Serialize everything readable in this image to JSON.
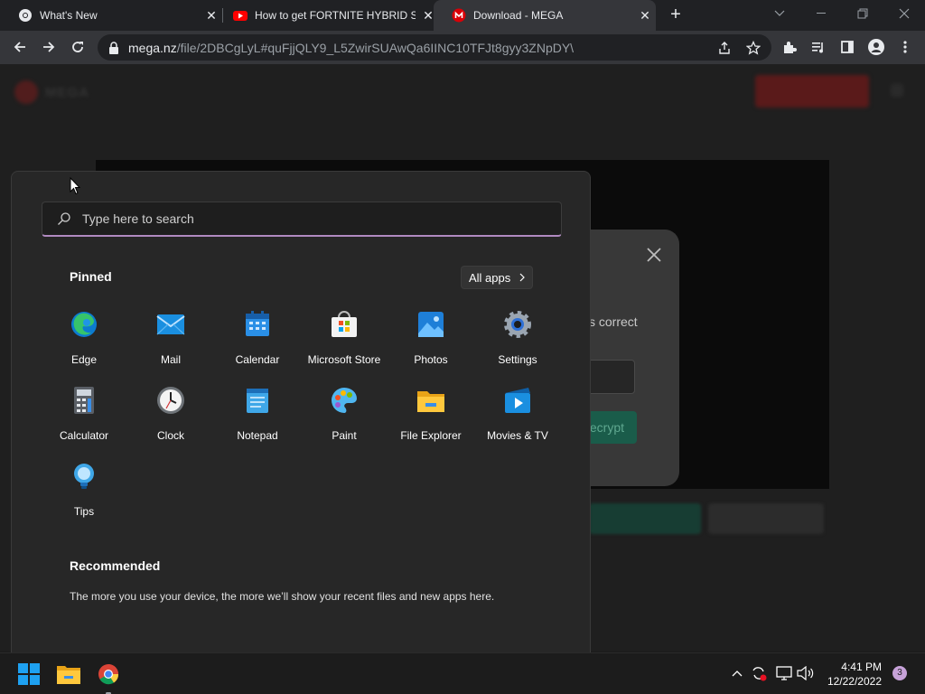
{
  "browser": {
    "tabs": [
      {
        "title": "What's New",
        "active": false
      },
      {
        "title": "How to get FORTNITE HYBRID SKIN",
        "active": false
      },
      {
        "title": "Download - MEGA",
        "active": true
      }
    ],
    "omnibox": {
      "host": "mega.nz",
      "path": "/file/2DBCgLyL#quFjjQLY9_L5ZwirSUAwQa6IINC10TFJt8gyy3ZNpDY\\"
    }
  },
  "page": {
    "dialog_text_fragment": "s correct",
    "dialog_button_fragment": "ecrypt"
  },
  "start_menu": {
    "search_placeholder": "Type here to search",
    "pinned_heading": "Pinned",
    "all_apps_label": "All apps",
    "apps": [
      {
        "label": "Edge",
        "icon": "edge-icon"
      },
      {
        "label": "Mail",
        "icon": "mail-icon"
      },
      {
        "label": "Calendar",
        "icon": "calendar-icon"
      },
      {
        "label": "Microsoft Store",
        "icon": "store-icon"
      },
      {
        "label": "Photos",
        "icon": "photos-icon"
      },
      {
        "label": "Settings",
        "icon": "settings-icon"
      },
      {
        "label": "Calculator",
        "icon": "calculator-icon"
      },
      {
        "label": "Clock",
        "icon": "clock-icon"
      },
      {
        "label": "Notepad",
        "icon": "notepad-icon"
      },
      {
        "label": "Paint",
        "icon": "paint-icon"
      },
      {
        "label": "File Explorer",
        "icon": "folder-icon"
      },
      {
        "label": "Movies & TV",
        "icon": "movies-icon"
      },
      {
        "label": "Tips",
        "icon": "tips-icon"
      }
    ],
    "recommended_heading": "Recommended",
    "recommended_text": "The more you use your device, the more we’ll show your recent files and new apps here."
  },
  "taskbar": {
    "time": "4:41 PM",
    "date": "12/22/2022",
    "notification_count": "3"
  },
  "colors": {
    "accent": "#b08ac0",
    "mega_red": "#d90007",
    "windows_blue": "#1ea1f1",
    "notif_badge": "#c7a2d9"
  }
}
